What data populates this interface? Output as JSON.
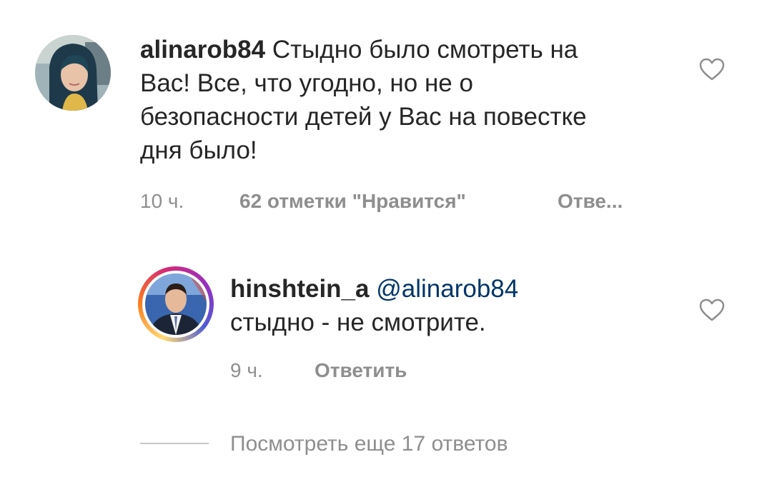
{
  "comments": [
    {
      "username": "alinarob84",
      "text": "Стыдно было смотреть на Вас! Все, что угодно, но не о безопасности детей у Вас на повестке дня было!",
      "time": "10 ч.",
      "likes": "62 отметки \"Нравится\"",
      "reply_label": "Отве...",
      "like_icon": "heart-outline-icon"
    },
    {
      "username": "hinshtein_a",
      "mention": "@alinarob84",
      "text": "стыдно - не смотрите.",
      "time": "9 ч.",
      "reply_label": "Ответить",
      "like_icon": "heart-outline-icon",
      "story_ring": true
    }
  ],
  "view_more_label": "Посмотреть еще 17 ответов",
  "colors": {
    "text": "#262626",
    "meta": "#8e8e8e",
    "mention": "#003569",
    "divider": "#c7c7c7"
  }
}
